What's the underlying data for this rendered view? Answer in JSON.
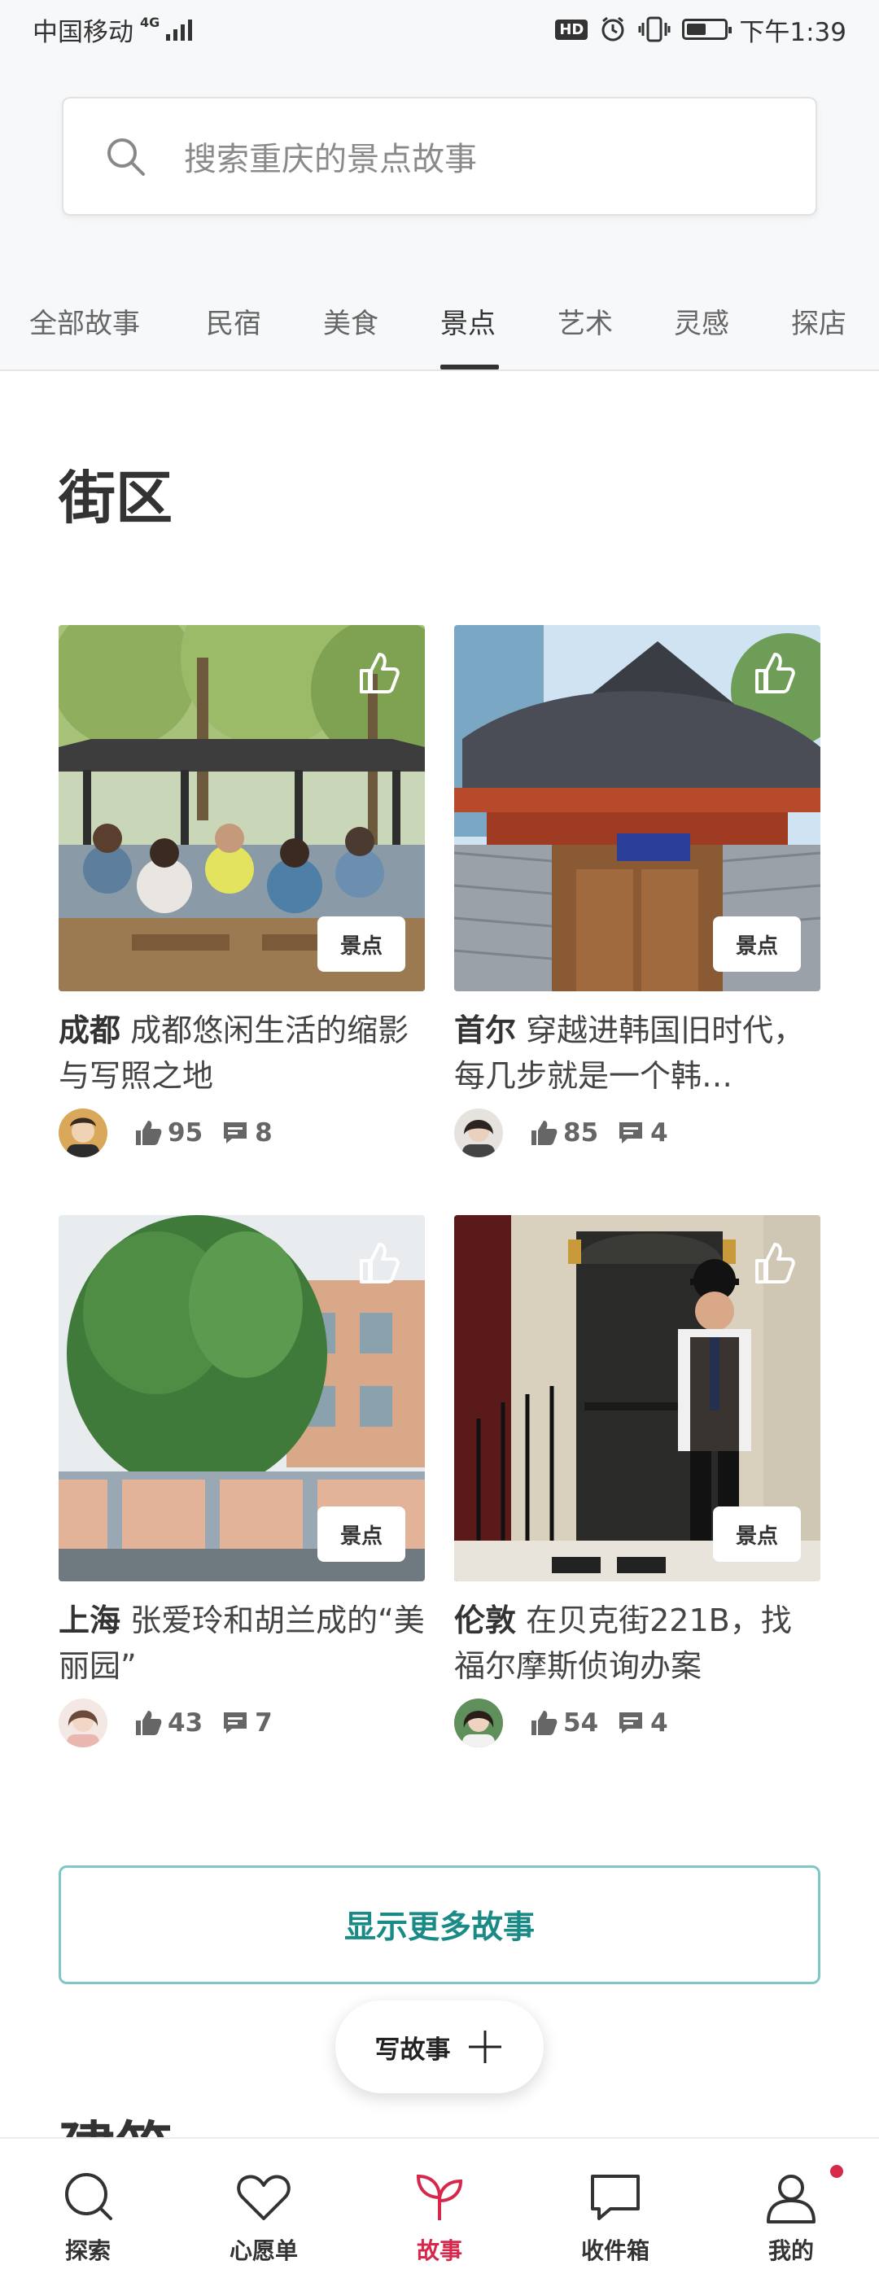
{
  "status_bar": {
    "carrier": "中国移动",
    "network": "4G",
    "hd": "HD",
    "time": "下午1:39"
  },
  "search": {
    "placeholder": "搜索重庆的景点故事",
    "icon": "search-icon"
  },
  "tabs": [
    {
      "label": "全部故事",
      "active": false
    },
    {
      "label": "民宿",
      "active": false
    },
    {
      "label": "美食",
      "active": false
    },
    {
      "label": "景点",
      "active": true
    },
    {
      "label": "艺术",
      "active": false
    },
    {
      "label": "灵感",
      "active": false
    },
    {
      "label": "探店",
      "active": false
    }
  ],
  "section": {
    "title": "街区",
    "next_title": "建筑"
  },
  "cards": [
    {
      "city": "成都",
      "desc": "成都悠闲生活的缩影与写照之地",
      "badge": "景点",
      "likes": "95",
      "comments": "8"
    },
    {
      "city": "首尔",
      "desc": "穿越进韩国旧时代，每几步就是一个韩…",
      "badge": "景点",
      "likes": "85",
      "comments": "4"
    },
    {
      "city": "上海",
      "desc": "张爱玲和胡兰成的“美丽园”",
      "badge": "景点",
      "likes": "43",
      "comments": "7"
    },
    {
      "city": "伦敦",
      "desc": "在贝克街221B，找福尔摩斯侦询办案",
      "badge": "景点",
      "likes": "54",
      "comments": "4"
    }
  ],
  "more_button": "显示更多故事",
  "write_button": "写故事",
  "bottom_nav": [
    {
      "label": "探索",
      "icon": "search-icon",
      "active": false
    },
    {
      "label": "心愿单",
      "icon": "heart-icon",
      "active": false
    },
    {
      "label": "故事",
      "icon": "sprout-icon",
      "active": true
    },
    {
      "label": "收件箱",
      "icon": "chat-bubble-icon",
      "active": false
    },
    {
      "label": "我的",
      "icon": "person-icon",
      "active": false
    }
  ],
  "colors": {
    "accent": "#d6284a",
    "teal": "#1a8a86",
    "teal_border": "#7fc7c4"
  }
}
